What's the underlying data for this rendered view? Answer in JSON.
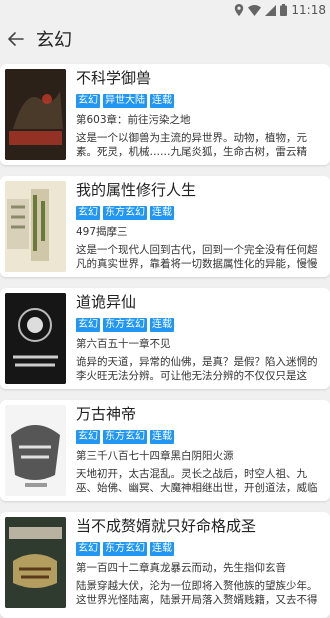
{
  "status": {
    "time": "11:18"
  },
  "appbar": {
    "title": "玄幻"
  },
  "books": [
    {
      "title": "不科学御兽",
      "tags": [
        "玄幻",
        "异世大陆",
        "连载"
      ],
      "latest": "第603章：前往污染之地",
      "desc": "这是一个以御兽为主流的异世界。动物，植物，元素。死灵，机械……九尾炎狐，生命古树，雷云精灵，骷髅…",
      "cover": {
        "bg": "#3a2a20",
        "accent": "#c0392b",
        "text": "不科学御兽"
      }
    },
    {
      "title": "我的属性修行人生",
      "tags": [
        "玄幻",
        "东方玄幻",
        "连载"
      ],
      "latest": "497揭摩三",
      "desc": "这是一个现代人回到古代，回到一个完全没有任何超凡的真实世界，靠着将一切数据属性化的异能，慢慢崛起…",
      "cover": {
        "bg": "#e8e0c8",
        "accent": "#6a7a3a",
        "text": "修行人生"
      }
    },
    {
      "title": "道诡异仙",
      "tags": [
        "玄幻",
        "东方玄幻",
        "连载"
      ],
      "latest": "第六百五十一章不见",
      "desc": "诡异的天道，异常的仙佛，是真？是假？陷入迷惘的李火旺无法分辨。可让他无法分辨的不仅仅只是这些。还…",
      "cover": {
        "bg": "#1a1a1a",
        "accent": "#ddd",
        "text": "道诡异仙"
      }
    },
    {
      "title": "万古神帝",
      "tags": [
        "玄幻",
        "东方玄幻",
        "连载"
      ],
      "latest": "第三千八百七十四章黑白阴阳火源",
      "desc": "天地初开，太古混乱。灵长之战后，时空人祖、九巫、始佛、幽冥、大魔神相继出世，开创道法，威临八方，…",
      "cover": {
        "bg": "#f2f2f2",
        "accent": "#222",
        "text": "万古神帝"
      }
    },
    {
      "title": "当不成赘婿就只好命格成圣",
      "tags": [
        "玄幻",
        "东方玄幻",
        "连载"
      ],
      "latest": "第一百四十二章真龙暴云而动，先生指仰玄音",
      "desc": "陆景穿越大伏，沦为一位即将入赘他族的望族少年。这世界光怪陆离，陆景开局落入赘婿贱籍，又去不得妻家…",
      "cover": {
        "bg": "#3b4a3a",
        "accent": "#e0c070",
        "text": "命格成圣"
      }
    }
  ]
}
